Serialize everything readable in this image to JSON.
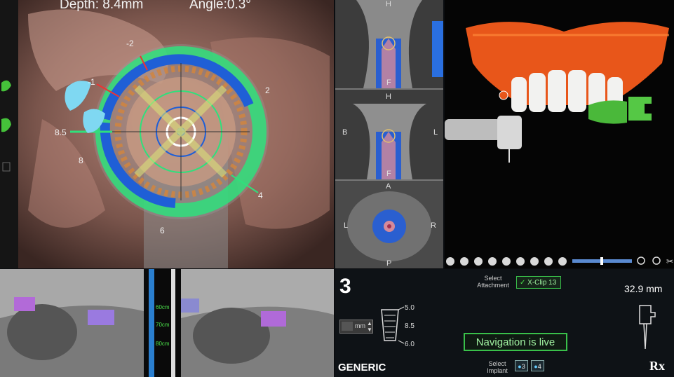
{
  "navigation_view": {
    "depth_label": "Depth: 8.4mm",
    "angle_label": "Angle:0.3°",
    "scale_labels": [
      "-2",
      "-1",
      "2",
      "8.5",
      "8",
      "4",
      "6"
    ]
  },
  "ct_slices": {
    "slice1": {
      "top": "H",
      "bottom": "F"
    },
    "slice2": {
      "top": "H",
      "left": "B",
      "right": "L",
      "bottom": "F"
    },
    "slice3": {
      "top": "A",
      "left": "L",
      "right": "R",
      "bottom": "P"
    }
  },
  "video_feed": {
    "ruler_labels": [
      "60cm",
      "70cm",
      "80cm"
    ]
  },
  "control_panel": {
    "implant_number": "3",
    "depth_unit": "mm",
    "drill_length_top": "5.0",
    "drill_length_mid": "8.5",
    "drill_length_bottom": "6.0",
    "select_attachment_label": "Select\nAttachment",
    "attachment_value": "X-Clip 13",
    "distance_value": "32.9 mm",
    "navigation_status": "Navigation is live",
    "select_implant_label": "Select\nImplant",
    "implant_options": [
      "3",
      "4"
    ],
    "brand_label": "GENERIC",
    "rx_label": "Rx"
  },
  "colors": {
    "accent_green": "#39c04a",
    "ring_blue": "#1f5fd6",
    "teeth_orange": "#e8561a"
  }
}
